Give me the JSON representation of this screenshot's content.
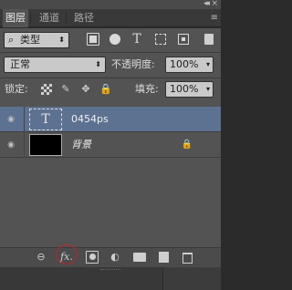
{
  "window": {
    "collapse_glyph": "◂◂",
    "close_glyph": "×",
    "panel_menu_glyph": "≡"
  },
  "tabs": [
    {
      "label": "图层",
      "active": true
    },
    {
      "label": "通道",
      "active": false
    },
    {
      "label": "路径",
      "active": false
    }
  ],
  "filter": {
    "kind_icon": "search-icon",
    "kind_label": "类型",
    "arrow": "⬍",
    "icons": [
      "pixel-filter-icon",
      "adjustment-filter-icon",
      "type-filter-icon",
      "shape-filter-icon",
      "smart-object-filter-icon",
      "filter-toggle-icon"
    ],
    "type_glyph": "T"
  },
  "blend": {
    "mode": "正常",
    "arrow": "⬍",
    "opacity_label": "不透明度:",
    "opacity_value": "100%",
    "opacity_arrow": "▾"
  },
  "lock": {
    "label": "锁定:",
    "icons": [
      "lock-transparent-icon",
      "lock-image-icon",
      "lock-position-icon",
      "lock-all-icon"
    ],
    "brush_glyph": "✎",
    "move_glyph": "✥",
    "lock_glyph": "🔒",
    "fill_label": "填充:",
    "fill_value": "100%",
    "fill_arrow": "▾"
  },
  "layers": [
    {
      "name": "0454ps",
      "kind": "text",
      "thumb_glyph": "T",
      "selected": true,
      "visible": true
    },
    {
      "name": "背景",
      "kind": "background",
      "selected": false,
      "visible": true,
      "locked": true
    }
  ],
  "eye_glyph": "◉",
  "bg_lock_glyph": "🔒",
  "bottom_toolbar": {
    "link_glyph": "⊖",
    "fx_label": "fx.",
    "fx_highlight_color": "#c02323",
    "adjust_glyph": "◐",
    "icons": [
      "link-layers-icon",
      "fx-icon",
      "add-mask-icon",
      "new-adjustment-icon",
      "new-group-icon",
      "new-layer-icon",
      "delete-layer-icon"
    ]
  },
  "colors": {
    "panel_bg": "#535353",
    "selected_row": "#5d7191",
    "tab_bar": "#393939"
  }
}
